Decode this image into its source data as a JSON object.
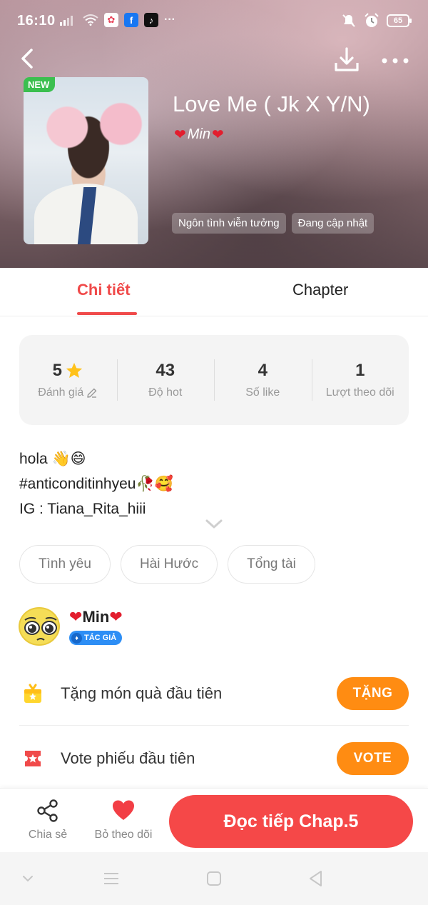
{
  "status_bar": {
    "time": "16:10",
    "app_badges": [
      {
        "name": "photos-app-icon",
        "glyph": "✿",
        "color": "#ffffff"
      },
      {
        "name": "facebook-app-icon",
        "glyph": "f",
        "color": "#1877f2"
      },
      {
        "name": "tiktok-app-icon",
        "glyph": "♪",
        "color": "#111111"
      }
    ],
    "more": "···",
    "battery": "65"
  },
  "header": {
    "new_badge": "NEW",
    "title": "Love Me ( Jk X Y/N)",
    "author_name": "Min",
    "heart": "❤",
    "genres": [
      "Ngôn tình viễn tưởng",
      "Đang cập nhật"
    ]
  },
  "tabs": {
    "detail": "Chi tiết",
    "chapter": "Chapter"
  },
  "stats": [
    {
      "value": "5",
      "label": "Đánh giá"
    },
    {
      "value": "43",
      "label": "Độ hot"
    },
    {
      "value": "4",
      "label": "Số like"
    },
    {
      "value": "1",
      "label": "Lượt theo dõi"
    }
  ],
  "description": {
    "line1": "hola 👋😄",
    "line2": "#anticonditinhyeu🥀🥰",
    "line3": "IG : Tiana_Rita_hiii"
  },
  "tags": [
    "Tình yêu",
    "Hài Hước",
    "Tổng tài"
  ],
  "author": {
    "name": "Min",
    "heart": "❤",
    "badge": "TÁC GIẢ"
  },
  "actions": {
    "gift_label": "Tặng món quà đầu tiên",
    "gift_button": "TẶNG",
    "vote_label": "Vote phiếu đầu tiên",
    "vote_button": "VOTE"
  },
  "bottom_bar": {
    "share": "Chia sẻ",
    "unfollow": "Bỏ theo dõi",
    "read": "Đọc tiếp Chap.5"
  },
  "colors": {
    "accent": "#f54848",
    "tab_active": "#f04a4a",
    "action_button": "#ff8c12",
    "new_badge": "#3bbf4f",
    "author_badge": "#2d8ef5"
  }
}
